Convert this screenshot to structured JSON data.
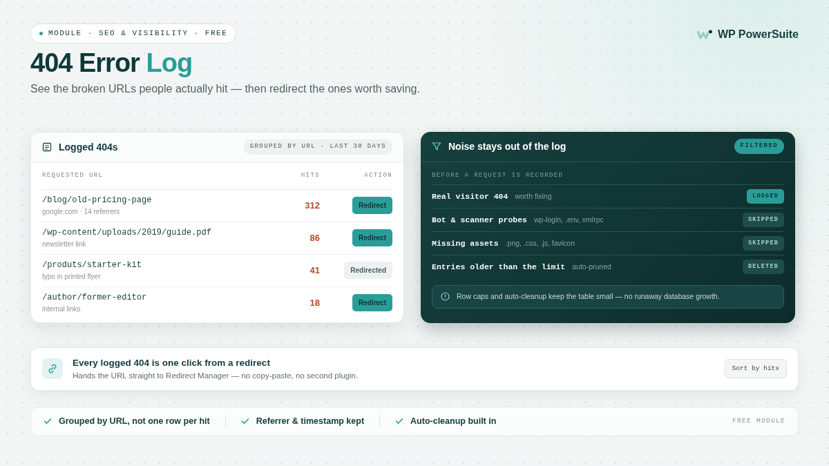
{
  "eyebrow": "MODULE · SEO & VISIBILITY · FREE",
  "brand": "WP PowerSuite",
  "title": {
    "main": "404 Error",
    "accent": "Log"
  },
  "subtitle": "See the broken URLs people actually hit — then redirect the ones worth saving.",
  "log_card": {
    "title": "Logged 404s",
    "badge": "GROUPED BY URL · LAST 30 DAYS",
    "columns": [
      "REQUESTED URL",
      "HITS",
      "ACTION"
    ],
    "rows": [
      {
        "url": "/blog/old-pricing-page",
        "source": "google.com · 14 referrers",
        "hits": "312",
        "action": {
          "kind": "redirect",
          "label": "Redirect"
        }
      },
      {
        "url": "/wp-content/uploads/2019/guide.pdf",
        "source": "newsletter link",
        "hits": "86",
        "action": {
          "kind": "redirect",
          "label": "Redirect"
        }
      },
      {
        "url": "/produts/starter-kit",
        "source": "typo in printed flyer",
        "hits": "41",
        "action": {
          "kind": "done",
          "label": "Redirected"
        }
      },
      {
        "url": "/author/former-editor",
        "source": "internal links",
        "hits": "18",
        "action": {
          "kind": "redirect",
          "label": "Redirect"
        }
      }
    ]
  },
  "filter_card": {
    "title": "Noise stays out of the log",
    "badge": "FILTERED",
    "section": "BEFORE A REQUEST IS RECORDED",
    "rows": [
      {
        "label": "Real visitor 404",
        "hint": "worth fixing",
        "status": {
          "kind": "logged",
          "label": "LOGGED"
        }
      },
      {
        "label": "Bot & scanner probes",
        "hint": "wp-login, .env, xmlrpc",
        "status": {
          "kind": "skipped",
          "label": "SKIPPED"
        }
      },
      {
        "label": "Missing assets",
        "hint": ".png, .css, .js, favicon",
        "status": {
          "kind": "skipped",
          "label": "SKIPPED"
        }
      },
      {
        "label": "Entries older than the limit",
        "hint": "auto-pruned",
        "status": {
          "kind": "deleted",
          "label": "DELETED"
        }
      }
    ],
    "note": "Row caps and auto-cleanup keep the table small — no runaway database growth."
  },
  "banner": {
    "title": "Every logged 404 is one click from a redirect",
    "text": "Hands the URL straight to Redirect Manager — no copy-paste, no second plugin.",
    "button": "Sort by hits"
  },
  "features": [
    "Grouped by URL, not one row per hit",
    "Referrer & timestamp kept",
    "Auto-cleanup built in"
  ],
  "footer_tag": "FREE MODULE"
}
